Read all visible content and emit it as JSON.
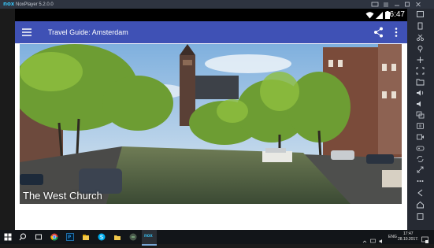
{
  "emulator": {
    "logo": "nox",
    "version": "NoxPlayer 5.2.0.0"
  },
  "status_bar": {
    "time": "6:47",
    "icons": [
      "wifi-icon",
      "signal-icon",
      "battery-icon"
    ]
  },
  "toolbar": {
    "title": "Travel Guide: Amsterdam",
    "icons": [
      "menu-icon",
      "share-icon",
      "overflow-icon"
    ]
  },
  "content": {
    "caption": "The West Church",
    "photo_subject": "canal-with-church-tower"
  },
  "taskbar": {
    "lang": "ENG",
    "time": "17:47",
    "date": "28.10.2017."
  },
  "colors": {
    "app_bar": "#3f51b5",
    "nox_accent": "#38c1f2",
    "taskbar": "#121519"
  }
}
